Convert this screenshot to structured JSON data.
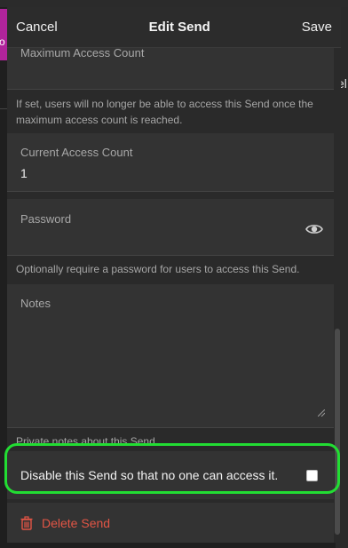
{
  "background": {
    "left_tab_text": "o",
    "right_hint_text": "el"
  },
  "header": {
    "cancel_label": "Cancel",
    "title": "Edit Send",
    "save_label": "Save"
  },
  "fields": {
    "max_access": {
      "label": "Maximum Access Count",
      "value": "",
      "help": "If set, users will no longer be able to access this Send once the maximum access count is reached."
    },
    "current_access": {
      "label": "Current Access Count",
      "value": "1"
    },
    "password": {
      "label": "Password",
      "value": "",
      "help": "Optionally require a password for users to access this Send."
    },
    "notes": {
      "label": "Notes",
      "value": "",
      "help": "Private notes about this Send."
    }
  },
  "disable_send": {
    "label": "Disable this Send so that no one can access it.",
    "checked": false
  },
  "delete_send": {
    "label": "Delete Send"
  },
  "colors": {
    "accent_highlight": "#22dd33",
    "danger": "#e25545",
    "brand_left": "#b0249b"
  }
}
